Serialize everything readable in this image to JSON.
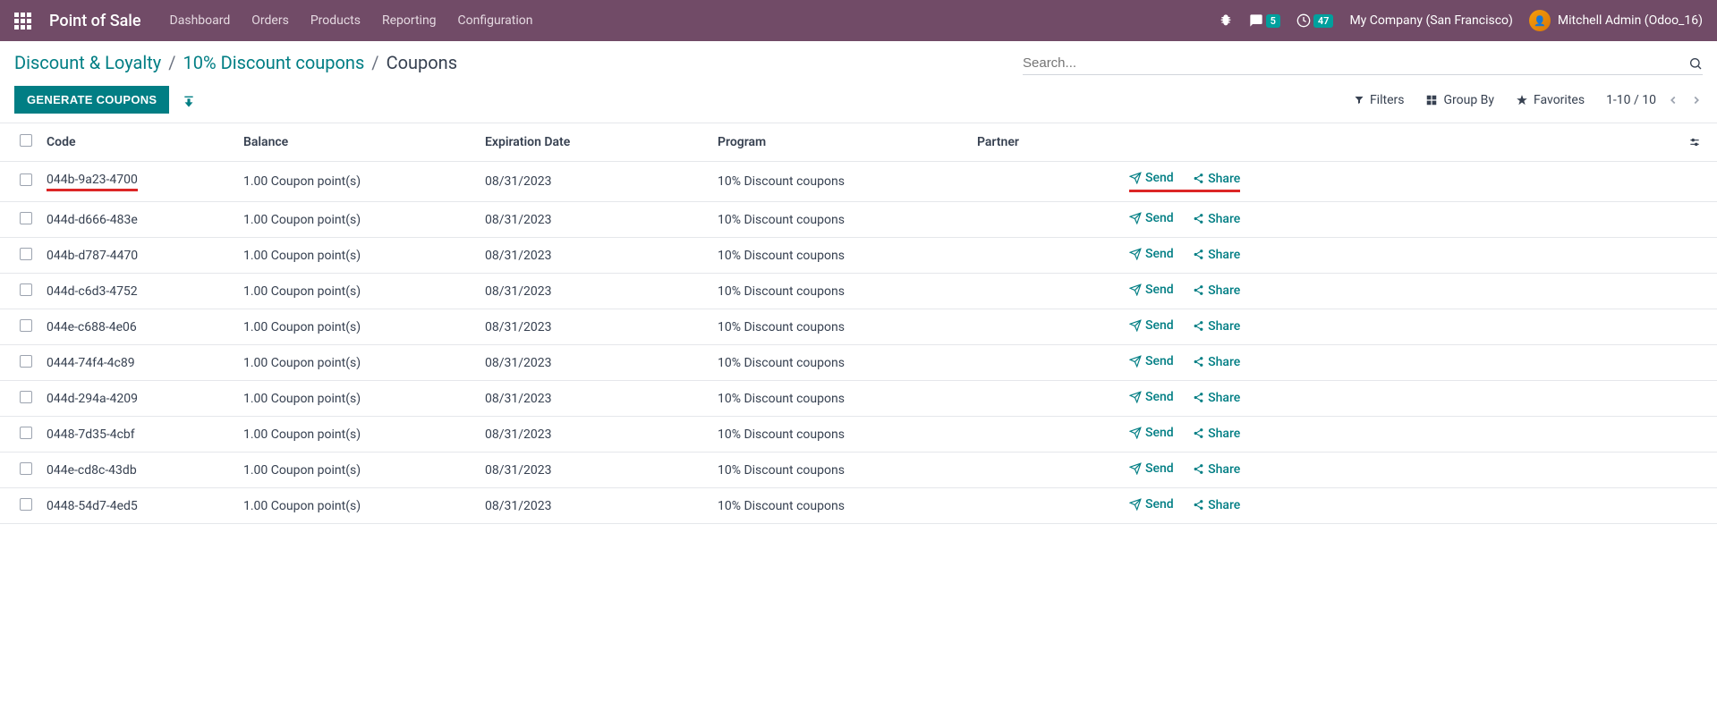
{
  "navbar": {
    "app_name": "Point of Sale",
    "menu": [
      "Dashboard",
      "Orders",
      "Products",
      "Reporting",
      "Configuration"
    ],
    "messages_badge": "5",
    "activities_badge": "47",
    "company": "My Company (San Francisco)",
    "user": "Mitchell Admin (Odoo_16)"
  },
  "breadcrumb": {
    "items": [
      "Discount & Loyalty",
      "10% Discount coupons"
    ],
    "current": "Coupons"
  },
  "controls": {
    "generate_btn": "GENERATE COUPONS",
    "search_placeholder": "Search...",
    "filters": "Filters",
    "group_by": "Group By",
    "favorites": "Favorites",
    "pager": "1-10 / 10"
  },
  "table": {
    "headers": {
      "code": "Code",
      "balance": "Balance",
      "expiration": "Expiration Date",
      "program": "Program",
      "partner": "Partner"
    },
    "actions": {
      "send": "Send",
      "share": "Share"
    },
    "rows": [
      {
        "code": "044b-9a23-4700",
        "balance": "1.00 Coupon point(s)",
        "expiration": "08/31/2023",
        "program": "10% Discount coupons",
        "partner": ""
      },
      {
        "code": "044d-d666-483e",
        "balance": "1.00 Coupon point(s)",
        "expiration": "08/31/2023",
        "program": "10% Discount coupons",
        "partner": ""
      },
      {
        "code": "044b-d787-4470",
        "balance": "1.00 Coupon point(s)",
        "expiration": "08/31/2023",
        "program": "10% Discount coupons",
        "partner": ""
      },
      {
        "code": "044d-c6d3-4752",
        "balance": "1.00 Coupon point(s)",
        "expiration": "08/31/2023",
        "program": "10% Discount coupons",
        "partner": ""
      },
      {
        "code": "044e-c688-4e06",
        "balance": "1.00 Coupon point(s)",
        "expiration": "08/31/2023",
        "program": "10% Discount coupons",
        "partner": ""
      },
      {
        "code": "0444-74f4-4c89",
        "balance": "1.00 Coupon point(s)",
        "expiration": "08/31/2023",
        "program": "10% Discount coupons",
        "partner": ""
      },
      {
        "code": "044d-294a-4209",
        "balance": "1.00 Coupon point(s)",
        "expiration": "08/31/2023",
        "program": "10% Discount coupons",
        "partner": ""
      },
      {
        "code": "0448-7d35-4cbf",
        "balance": "1.00 Coupon point(s)",
        "expiration": "08/31/2023",
        "program": "10% Discount coupons",
        "partner": ""
      },
      {
        "code": "044e-cd8c-43db",
        "balance": "1.00 Coupon point(s)",
        "expiration": "08/31/2023",
        "program": "10% Discount coupons",
        "partner": ""
      },
      {
        "code": "0448-54d7-4ed5",
        "balance": "1.00 Coupon point(s)",
        "expiration": "08/31/2023",
        "program": "10% Discount coupons",
        "partner": ""
      }
    ]
  }
}
